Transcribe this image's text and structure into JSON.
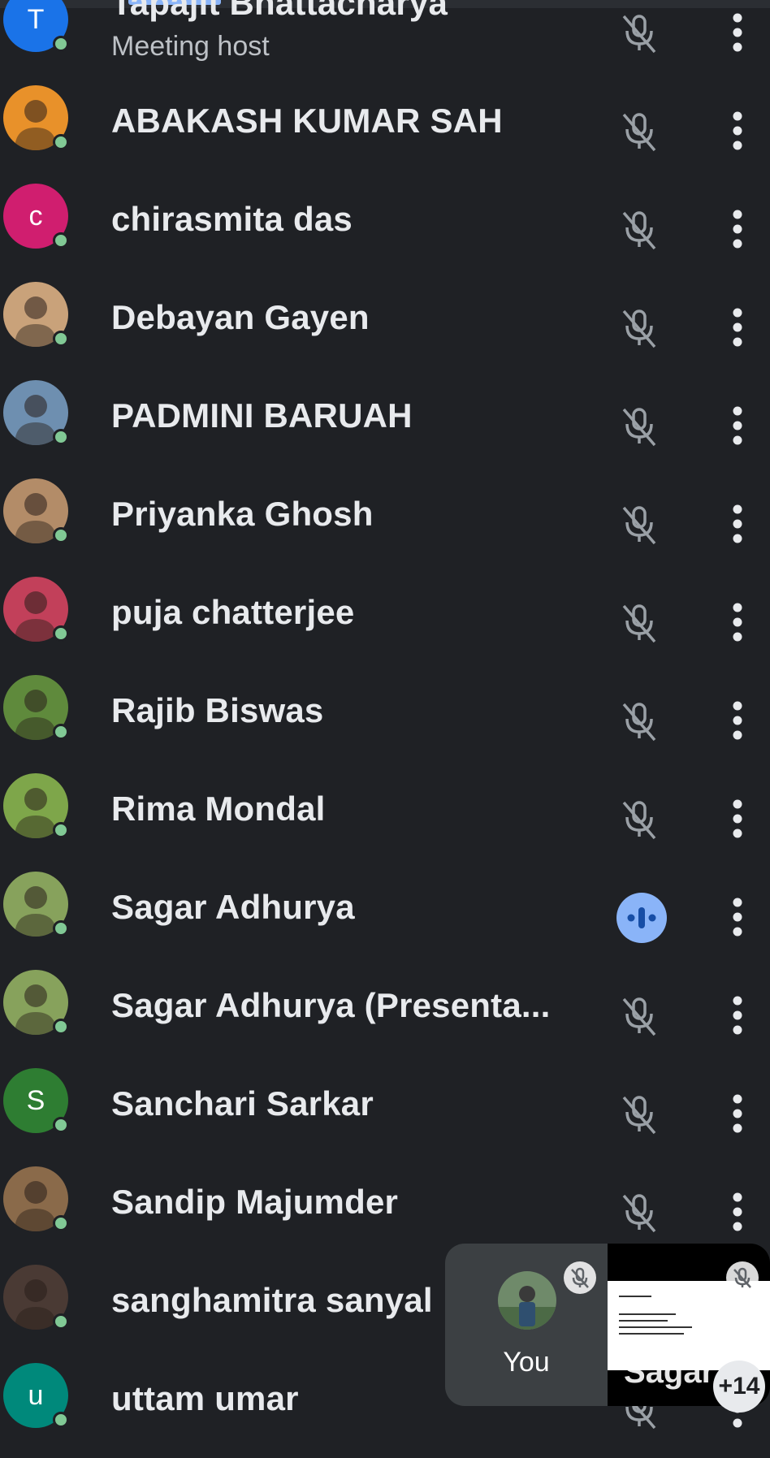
{
  "participants": [
    {
      "name": "Tapajit Bhattacharya",
      "role": "Meeting host",
      "initial": "T",
      "avatar_color": "#1a73e8",
      "muted": true
    },
    {
      "name": "ABAKASH KUMAR SAH",
      "role": "",
      "initial": "",
      "avatar_color": "#e8912a",
      "muted": true
    },
    {
      "name": "chirasmita das",
      "role": "",
      "initial": "c",
      "avatar_color": "#d01e6f",
      "muted": true
    },
    {
      "name": "Debayan Gayen",
      "role": "",
      "initial": "",
      "avatar_color": "#c9a27a",
      "muted": true
    },
    {
      "name": "PADMINI BARUAH",
      "role": "",
      "initial": "",
      "avatar_color": "#6e8fb0",
      "muted": true
    },
    {
      "name": "Priyanka Ghosh",
      "role": "",
      "initial": "",
      "avatar_color": "#b38c68",
      "muted": true
    },
    {
      "name": "puja chatterjee",
      "role": "",
      "initial": "",
      "avatar_color": "#c2405a",
      "muted": true
    },
    {
      "name": "Rajib Biswas",
      "role": "",
      "initial": "",
      "avatar_color": "#5f8a3c",
      "muted": true
    },
    {
      "name": "Rima Mondal",
      "role": "",
      "initial": "",
      "avatar_color": "#7ea64a",
      "muted": true
    },
    {
      "name": "Sagar Adhurya",
      "role": "",
      "initial": "",
      "avatar_color": "#87a25c",
      "muted": false,
      "speaking": true
    },
    {
      "name": "Sagar Adhurya (Presenta...",
      "role": "",
      "initial": "",
      "avatar_color": "#87a25c",
      "muted": true
    },
    {
      "name": "Sanchari Sarkar",
      "role": "",
      "initial": "S",
      "avatar_color": "#2e7d32",
      "muted": true
    },
    {
      "name": "Sandip Majumder",
      "role": "",
      "initial": "",
      "avatar_color": "#8a6a4a",
      "muted": true
    },
    {
      "name": "sanghamitra sanyal",
      "role": "",
      "initial": "",
      "avatar_color": "#4a3a34",
      "muted": true
    },
    {
      "name": "uttam umar",
      "role": "",
      "initial": "u",
      "avatar_color": "#00897b",
      "muted": true
    }
  ],
  "pip": {
    "self_label": "You",
    "share_label": "Sagar",
    "more_count": "+14"
  },
  "colors": {
    "background": "#1f2125",
    "online": "#81c995",
    "speaking": "#8ab4f8"
  }
}
